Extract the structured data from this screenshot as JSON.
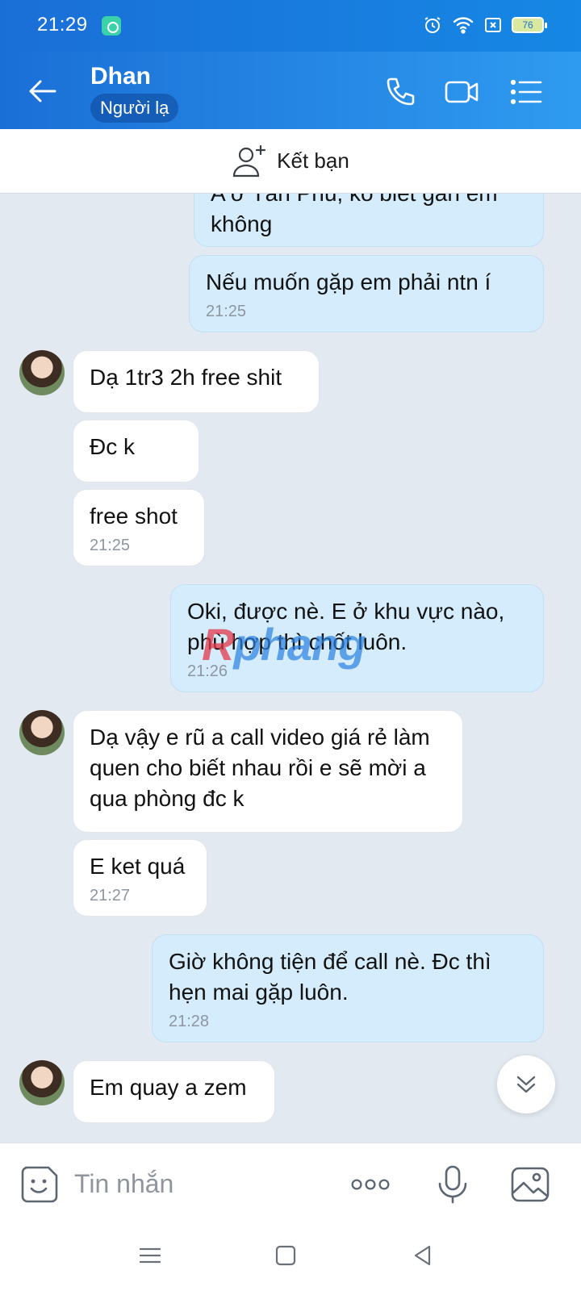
{
  "status_bar": {
    "time": "21:29",
    "battery": "76"
  },
  "header": {
    "contact_name": "Dhan",
    "tag": "Người lạ"
  },
  "add_friend": {
    "label": "Kết bạn"
  },
  "messages": [
    {
      "side": "out",
      "text": "A ở Tân Phú, ko biết gần em không",
      "time": ""
    },
    {
      "side": "out",
      "text": "Nếu muốn gặp em phải ntn í",
      "time": "21:25"
    },
    {
      "side": "in",
      "text": "Dạ 1tr3 2h free shit",
      "time": ""
    },
    {
      "side": "in",
      "text": "Đc k",
      "time": ""
    },
    {
      "side": "in",
      "text": "free shot",
      "time": "21:25"
    },
    {
      "side": "out",
      "text": "Oki, được nè. E ở khu vực nào, phù hợp thì chốt luôn.",
      "time": "21:26"
    },
    {
      "side": "in",
      "text": "Dạ vậy e rũ a call video giá rẻ làm quen cho biết nhau rồi e sẽ mời a qua phòng đc k",
      "time": ""
    },
    {
      "side": "in",
      "text": "E ket quá",
      "time": "21:27"
    },
    {
      "side": "out",
      "text": "Giờ không tiện để call nè. Đc thì hẹn mai gặp luôn.",
      "time": "21:28"
    },
    {
      "side": "in",
      "text": "Em quay a zem",
      "time": ""
    }
  ],
  "watermark": {
    "first_letter": "R",
    "rest": "phang"
  },
  "input_bar": {
    "placeholder": "Tin nhắn"
  },
  "icons": {
    "back": "arrow-left-icon",
    "call": "phone-icon",
    "video": "video-camera-icon",
    "menu": "list-menu-icon",
    "add_friend": "add-person-icon",
    "emoji": "sticker-icon",
    "more": "more-dots-icon",
    "mic": "microphone-icon",
    "gallery": "image-icon",
    "scroll_down": "double-chevron-down-icon"
  },
  "colors": {
    "header_start": "#1a6fd6",
    "header_end": "#2f9bf0",
    "chat_bg": "#e2e9f1",
    "outgoing_bubble": "#d4ecfb",
    "incoming_bubble": "#ffffff"
  }
}
